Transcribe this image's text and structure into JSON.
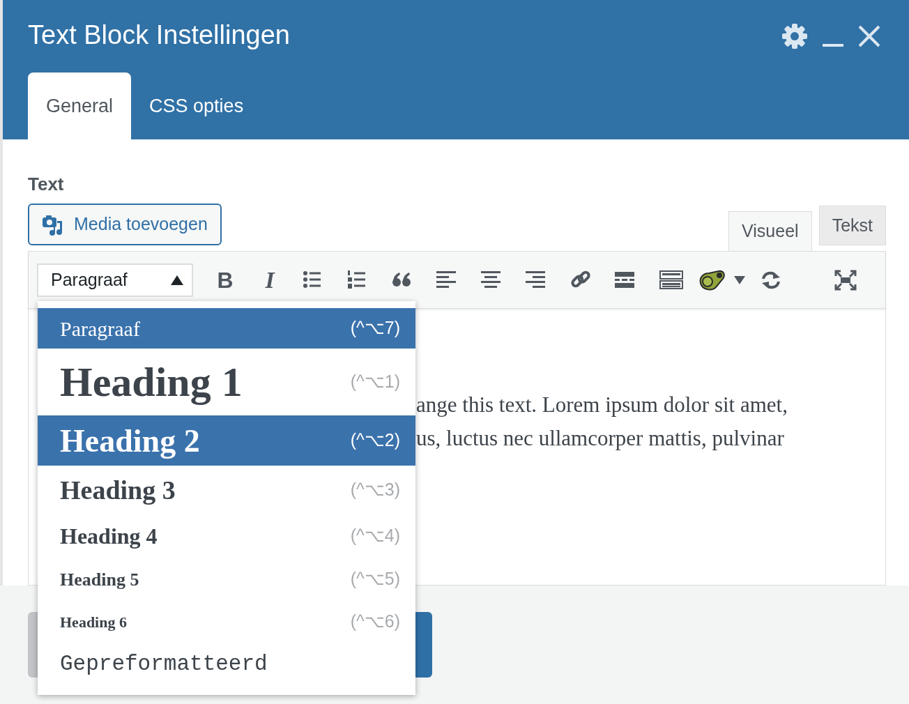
{
  "window": {
    "title": "Text Block Instellingen"
  },
  "tabs": [
    {
      "label": "General",
      "selected": true
    },
    {
      "label": "CSS opties",
      "selected": false
    }
  ],
  "field_label": "Text",
  "media_button": "Media toevoegen",
  "editor_tabs": [
    {
      "label": "Visueel",
      "selected": true
    },
    {
      "label": "Tekst",
      "selected": false
    }
  ],
  "format_select": {
    "value": "Paragraaf",
    "expanded": true
  },
  "toolbar": [
    {
      "kind": "bold",
      "glyph": "B"
    },
    {
      "kind": "italic",
      "glyph": "I"
    },
    {
      "kind": "bullets"
    },
    {
      "kind": "numbers"
    },
    {
      "kind": "quote"
    },
    {
      "kind": "align-left"
    },
    {
      "kind": "align-center"
    },
    {
      "kind": "align-right"
    },
    {
      "kind": "link"
    },
    {
      "kind": "more"
    },
    {
      "kind": "toolbar"
    },
    {
      "kind": "plugin"
    },
    {
      "kind": "refresh"
    },
    {
      "kind": "spacer"
    },
    {
      "kind": "fullscreen"
    }
  ],
  "content_lines": [
    "ange this text. Lorem ipsum dolor sit amet,",
    "us, luctus nec ullamcorper mattis, pulvinar"
  ],
  "format_menu": [
    {
      "kind": "paragraph",
      "label": "Paragraaf",
      "shortcut": "(^⌥7)",
      "highlighted": true
    },
    {
      "kind": "h1",
      "label": "Heading 1",
      "shortcut": "(^⌥1)",
      "highlighted": false
    },
    {
      "kind": "h2",
      "label": "Heading 2",
      "shortcut": "(^⌥2)",
      "highlighted": true
    },
    {
      "kind": "h3",
      "label": "Heading 3",
      "shortcut": "(^⌥3)",
      "highlighted": false
    },
    {
      "kind": "h4",
      "label": "Heading 4",
      "shortcut": "(^⌥4)",
      "highlighted": false
    },
    {
      "kind": "h5",
      "label": "Heading 5",
      "shortcut": "(^⌥5)",
      "highlighted": false
    },
    {
      "kind": "h6",
      "label": "Heading 6",
      "shortcut": "(^⌥6)",
      "highlighted": false
    },
    {
      "kind": "pre",
      "label": "Gepreformatteerd",
      "highlighted": false
    }
  ],
  "footer_buttons": [
    {
      "kind": "secondary"
    },
    {
      "kind": "primary"
    }
  ]
}
